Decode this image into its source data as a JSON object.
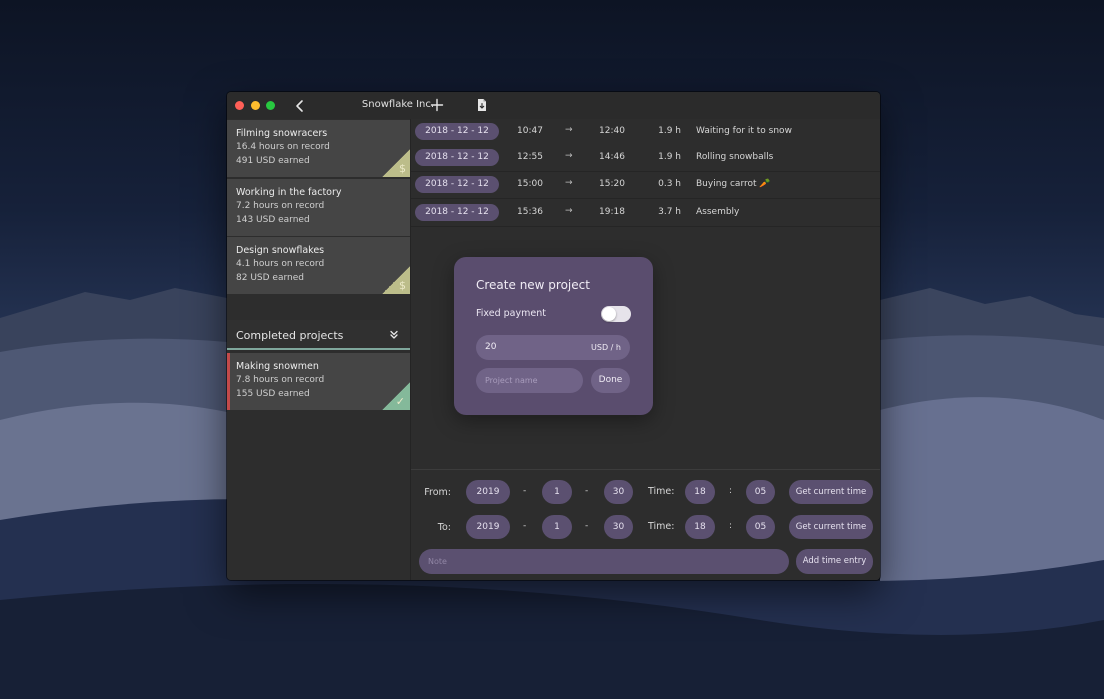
{
  "window": {
    "title": "Snowflake Inc."
  },
  "icons": {
    "back": "chevron-left-icon",
    "add": "plus-icon",
    "export": "document-icon",
    "collapse": "double-chevron-down-icon",
    "earned": "dollar-icon",
    "completed": "checkmark-icon"
  },
  "colors": {
    "accent": "#5b5070",
    "modal": "#5a4d6e",
    "dollar_badge": "#bcbd8a",
    "check_badge": "#84b99a",
    "active_marker": "#c24a4a"
  },
  "sidebar": {
    "projects": [
      {
        "name": "Filming snowracers",
        "hours": "16.4 hours on record",
        "earned": "491 USD earned",
        "badge": "$"
      },
      {
        "name": "Working in the factory",
        "hours": "7.2 hours on record",
        "earned": "143 USD earned",
        "badge": ""
      },
      {
        "name": "Design snowflakes",
        "hours": "4.1 hours on record",
        "earned": "82 USD earned",
        "badge": "$"
      }
    ],
    "completed_header": "Completed projects",
    "completed": [
      {
        "name": "Making snowmen",
        "hours": "7.8 hours on record",
        "earned": "155 USD earned",
        "badge": "✓"
      }
    ]
  },
  "entries": [
    {
      "date": "2018 - 12 - 12",
      "start": "10:47",
      "arrow": "→",
      "end": "12:40",
      "duration": "1.9 h",
      "description": "Waiting for it to snow"
    },
    {
      "date": "2018 - 12 - 12",
      "start": "12:55",
      "arrow": "→",
      "end": "14:46",
      "duration": "1.9 h",
      "description": "Rolling snowballs"
    },
    {
      "date": "2018 - 12 - 12",
      "start": "15:00",
      "arrow": "→",
      "end": "15:20",
      "duration": "0.3 h",
      "description": "Buying carrot 🥕"
    },
    {
      "date": "2018 - 12 - 12",
      "start": "15:36",
      "arrow": "→",
      "end": "19:18",
      "duration": "3.7 h",
      "description": "Assembly"
    }
  ],
  "modal": {
    "title": "Create new project",
    "fixed_payment_label": "Fixed payment",
    "fixed_payment_on": false,
    "rate_value": "20",
    "rate_unit": "USD / h",
    "name_placeholder": "Project name",
    "done_label": "Done"
  },
  "time_entry": {
    "from_label": "From:",
    "to_label": "To:",
    "time_label": "Time:",
    "date_sep": "-",
    "time_sep": ":",
    "from": {
      "year": "2019",
      "month": "1",
      "day": "30",
      "hour": "18",
      "minute": "05"
    },
    "to": {
      "year": "2019",
      "month": "1",
      "day": "30",
      "hour": "18",
      "minute": "05"
    },
    "get_current_time_label": "Get current time",
    "note_placeholder": "Note",
    "add_label": "Add time entry"
  }
}
